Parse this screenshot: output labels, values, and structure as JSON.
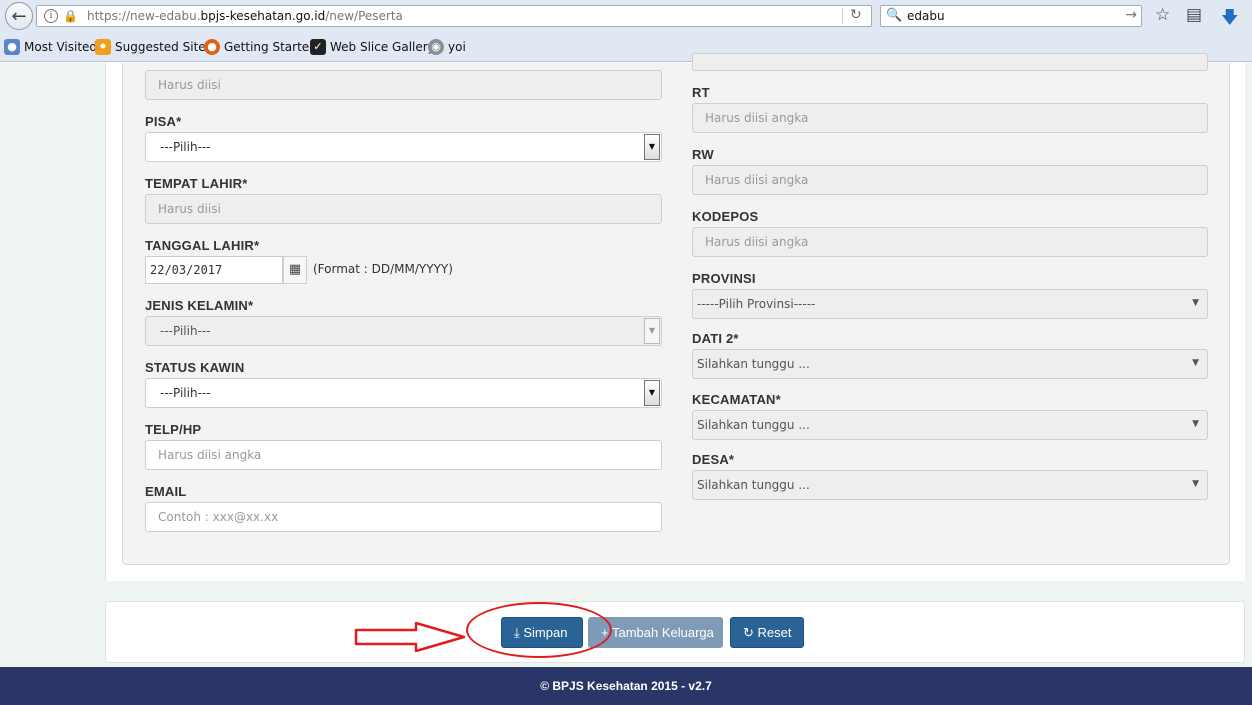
{
  "browser": {
    "url_prefix": "https://new-edabu.",
    "url_domain": "bpjs-kesehatan.go.id",
    "url_path": "/new/Peserta",
    "search_value": "edabu",
    "bookmarks": [
      {
        "label": "Most Visited"
      },
      {
        "label": "Suggested Sites"
      },
      {
        "label": "Getting Started"
      },
      {
        "label": "Web Slice Gallery"
      },
      {
        "label": "yoi"
      }
    ]
  },
  "form": {
    "top_field": {
      "placeholder": "Harus diisi"
    },
    "pisa": {
      "label": "PISA*",
      "value": "---Pilih---"
    },
    "tempat_lahir": {
      "label": "TEMPAT LAHIR*",
      "placeholder": "Harus diisi"
    },
    "tanggal_lahir": {
      "label": "TANGGAL LAHIR*",
      "value": "22/03/2017",
      "format": "(Format : DD/MM/YYYY)"
    },
    "jenis_kelamin": {
      "label": "JENIS KELAMIN*",
      "value": "---Pilih---"
    },
    "status_kawin": {
      "label": "STATUS KAWIN",
      "value": "---Pilih---"
    },
    "telp": {
      "label": "TELP/HP",
      "placeholder": "Harus diisi angka"
    },
    "email": {
      "label": "EMAIL",
      "placeholder": "Contoh : xxx@xx.xx"
    },
    "rt": {
      "label": "RT",
      "placeholder": "Harus diisi angka"
    },
    "rw": {
      "label": "RW",
      "placeholder": "Harus diisi angka"
    },
    "kodepos": {
      "label": "KODEPOS",
      "placeholder": "Harus diisi angka"
    },
    "provinsi": {
      "label": "PROVINSI",
      "value": "-----Pilih Provinsi-----"
    },
    "dati2": {
      "label": "DATI 2*",
      "value": "Silahkan tunggu ..."
    },
    "kecamatan": {
      "label": "KECAMATAN*",
      "value": "Silahkan tunggu ..."
    },
    "desa": {
      "label": "DESA*",
      "value": "Silahkan tunggu ..."
    }
  },
  "actions": {
    "simpan": "Simpan",
    "tambah": "Tambah Keluarga",
    "reset": "Reset"
  },
  "footer": {
    "text": "© BPJS Kesehatan 2015 - v2.7"
  },
  "colors": {
    "primary_button": "#2a6496",
    "footer_bg": "#2b3668",
    "annotation": "#e11b1b"
  }
}
